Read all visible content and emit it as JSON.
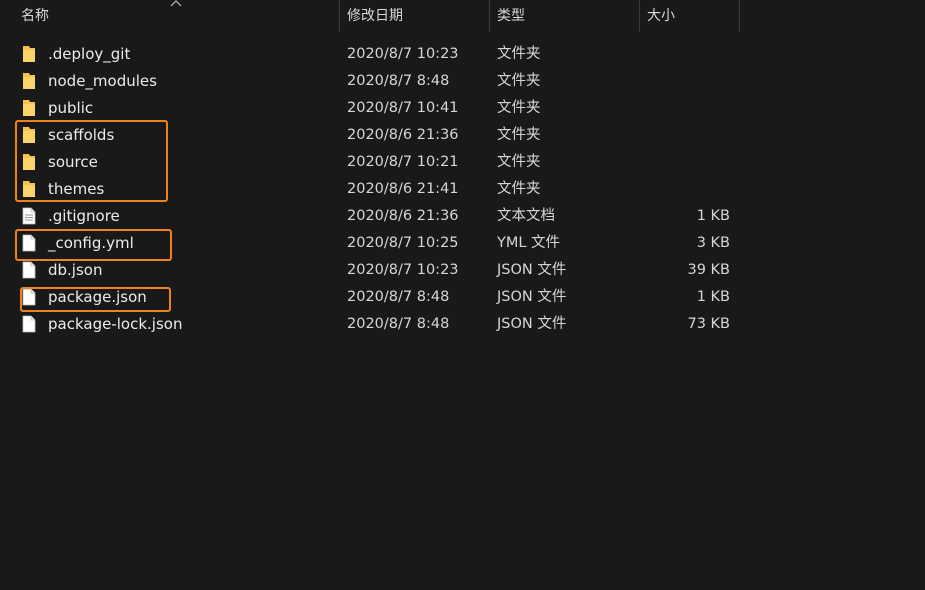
{
  "columns": {
    "name": "名称",
    "date": "修改日期",
    "type": "类型",
    "size": "大小"
  },
  "colors": {
    "background": "#191919",
    "folder": "#f5c24c",
    "highlight": "#f0821e"
  },
  "files": [
    {
      "name": ".deploy_git",
      "date": "2020/8/7 10:23",
      "type": "文件夹",
      "size": "",
      "icon": "folder-icon"
    },
    {
      "name": "node_modules",
      "date": "2020/8/7 8:48",
      "type": "文件夹",
      "size": "",
      "icon": "folder-icon"
    },
    {
      "name": "public",
      "date": "2020/8/7 10:41",
      "type": "文件夹",
      "size": "",
      "icon": "folder-icon"
    },
    {
      "name": "scaffolds",
      "date": "2020/8/6 21:36",
      "type": "文件夹",
      "size": "",
      "icon": "folder-icon"
    },
    {
      "name": "source",
      "date": "2020/8/7 10:21",
      "type": "文件夹",
      "size": "",
      "icon": "folder-icon"
    },
    {
      "name": "themes",
      "date": "2020/8/6 21:41",
      "type": "文件夹",
      "size": "",
      "icon": "folder-icon"
    },
    {
      "name": ".gitignore",
      "date": "2020/8/6 21:36",
      "type": "文本文档",
      "size": "1 KB",
      "icon": "text-file-icon"
    },
    {
      "name": "_config.yml",
      "date": "2020/8/7 10:25",
      "type": "YML 文件",
      "size": "3 KB",
      "icon": "file-icon"
    },
    {
      "name": "db.json",
      "date": "2020/8/7 10:23",
      "type": "JSON 文件",
      "size": "39 KB",
      "icon": "file-icon"
    },
    {
      "name": "package.json",
      "date": "2020/8/7 8:48",
      "type": "JSON 文件",
      "size": "1 KB",
      "icon": "file-icon"
    },
    {
      "name": "package-lock.json",
      "date": "2020/8/7 8:48",
      "type": "JSON 文件",
      "size": "73 KB",
      "icon": "file-icon"
    }
  ]
}
